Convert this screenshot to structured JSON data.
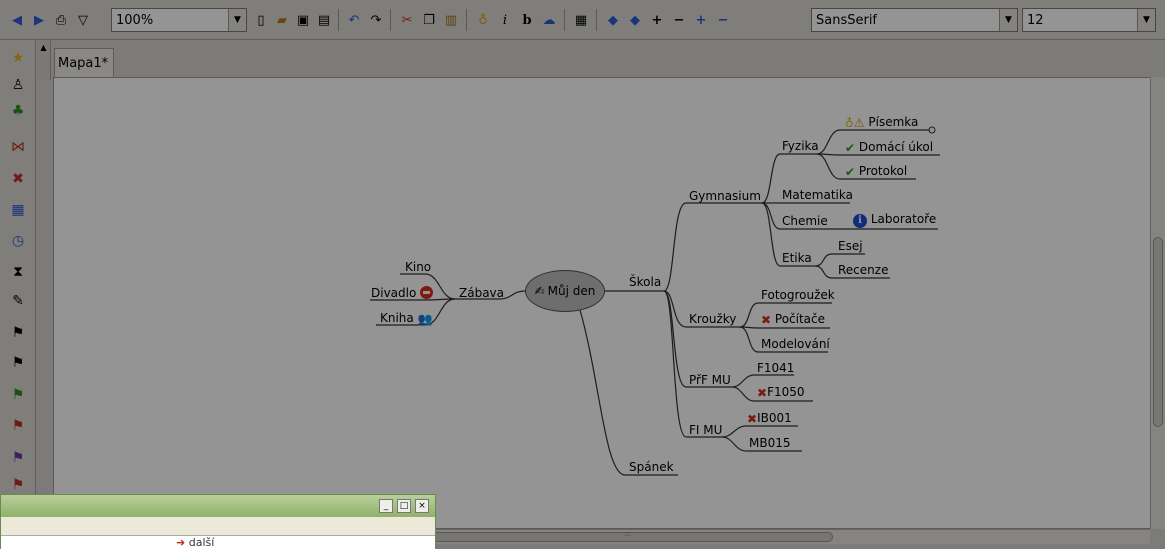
{
  "toolbar": {
    "zoom_value": "100%",
    "font_family_value": "SansSerif",
    "font_size_value": "12",
    "buttons": [
      "back-icon",
      "forward-icon",
      "print-icon",
      "filter-icon",
      "new-icon",
      "open-icon",
      "save-icon",
      "save-as-icon",
      "undo-icon",
      "redo-icon",
      "cut-icon",
      "copy-icon",
      "paste-icon",
      "idea-icon",
      "italic-icon",
      "bold-icon",
      "cloud-icon",
      "calculator-icon",
      "arrow-left-icon",
      "arrow-right-icon",
      "plus-icon",
      "minus-icon",
      "blue-plus-icon",
      "blue-minus-icon"
    ]
  },
  "leftbar": {
    "icons": [
      "star-icon",
      "linux-icon",
      "clover-icon",
      "butterfly-icon",
      "tools-icon",
      "calendar-icon",
      "clock-icon",
      "hourglass-icon",
      "pen-icon",
      "flag-icon",
      "flag-icon",
      "flag-icon",
      "flag-icon",
      "flag-icon",
      "flag-icon"
    ]
  },
  "tabs": [
    {
      "label": "Mapa1*"
    }
  ],
  "map": {
    "root": "Můj den",
    "left": {
      "zabava": "Zábava",
      "kino": "Kino",
      "divadlo": "Divadlo",
      "kniha": "Kniha"
    },
    "right": {
      "skola": "Škola",
      "spanek": "Spánek",
      "gymnasium": "Gymnasium",
      "fyzika": "Fyzika",
      "pisemka": "Písemka",
      "domaci_ukol": "Domácí úkol",
      "protokol": "Protokol",
      "matematika": "Matematika",
      "chemie": "Chemie",
      "laboratore": "Laboratoře",
      "etika": "Etika",
      "esej": "Esej",
      "recenze": "Recenze",
      "krouzky": "Kroužky",
      "fotogrouzek": "Fotogroužek",
      "pocitace": "Počítače",
      "modelovani": "Modelování",
      "prf_mu": "PřF MU",
      "f1041": "F1041",
      "f1050": "F1050",
      "fi_mu": "FI MU",
      "ib001": "IB001",
      "mb015": "MB015"
    }
  },
  "floating_window": {
    "body_text": "další",
    "buttons": [
      "minimize",
      "maximize",
      "close"
    ]
  },
  "colors": {
    "check": "#1a9a20",
    "cross": "#d62b1d",
    "info": "#1e4fd0",
    "root_fill": "#bdbdbd"
  }
}
